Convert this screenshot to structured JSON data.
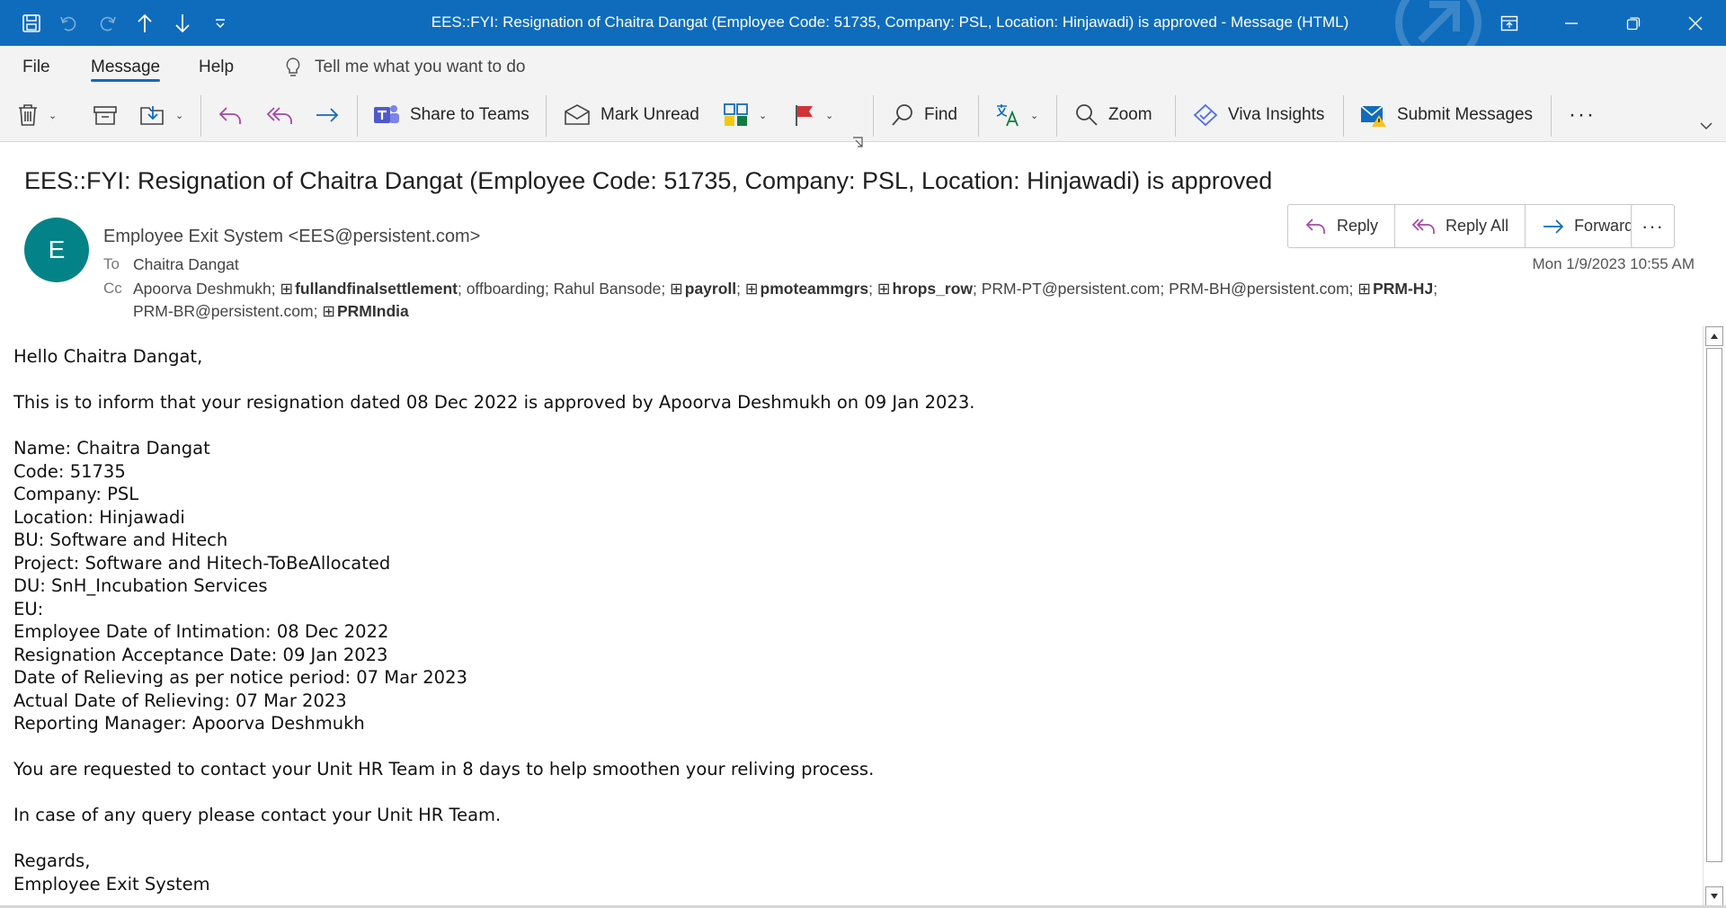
{
  "window": {
    "title": "EES::FYI: Resignation of Chaitra Dangat (Employee Code: 51735, Company: PSL, Location: Hinjawadi) is approved  -  Message (HTML)",
    "accent": "#0f6cbd"
  },
  "menu": {
    "tabs": [
      "File",
      "Message",
      "Help"
    ],
    "active": "Message",
    "tell_me": "Tell me what you want to do"
  },
  "ribbon": {
    "share_to_teams": "Share to Teams",
    "mark_unread": "Mark Unread",
    "find": "Find",
    "zoom": "Zoom",
    "viva_insights": "Viva Insights",
    "submit_messages": "Submit Messages"
  },
  "message": {
    "subject": "EES::FYI: Resignation of Chaitra Dangat (Employee Code: 51735, Company: PSL, Location: Hinjawadi) is approved",
    "avatar_initial": "E",
    "avatar_color": "#038387",
    "sender": "Employee Exit System <EES@persistent.com>",
    "to_label": "To",
    "to": "Chaitra Dangat",
    "cc_label": "Cc",
    "cc_1": "Apoorva Deshmukh;",
    "cc_2": "fullandfinalsettlement",
    "cc_3": "; offboarding; Rahul Bansode;",
    "cc_4": "payroll",
    "cc_5": "pmoteammgrs",
    "cc_6": "hrops_row",
    "cc_7": "; PRM-PT@persistent.com; PRM-BH@persistent.com;",
    "cc_8": "PRM-HJ",
    "cc_9": "PRM-BR@persistent.com;",
    "cc_10": "PRMIndia",
    "received": "Mon 1/9/2023 10:55 AM",
    "actions": {
      "reply": "Reply",
      "reply_all": "Reply All",
      "forward": "Forward"
    }
  },
  "body": {
    "greeting": "Hello Chaitra Dangat,",
    "intro": "This is to inform that your resignation dated 08 Dec 2022 is approved by Apoorva Deshmukh on 09 Jan 2023.",
    "name": "Name: Chaitra Dangat",
    "code": "Code: 51735",
    "company": "Company: PSL",
    "location": "Location: Hinjawadi",
    "bu": "BU: Software and Hitech",
    "project": "Project: Software and Hitech-ToBeAllocated",
    "du": "DU: SnH_Incubation Services",
    "eu": "EU:",
    "intimation": "Employee Date of Intimation: 08 Dec 2022",
    "acceptance": "Resignation Acceptance Date: 09 Jan 2023",
    "relieving_notice": "Date of Relieving as per notice period: 07 Mar 2023",
    "relieving_actual": "Actual Date of Relieving: 07 Mar 2023",
    "manager": "Reporting Manager: Apoorva Deshmukh",
    "request": "You are requested to contact your Unit HR Team in 8 days to help smoothen your reliving process.",
    "query": "In case of any query please contact your Unit HR Team.",
    "regards": "Regards,",
    "signature": "Employee Exit System"
  }
}
